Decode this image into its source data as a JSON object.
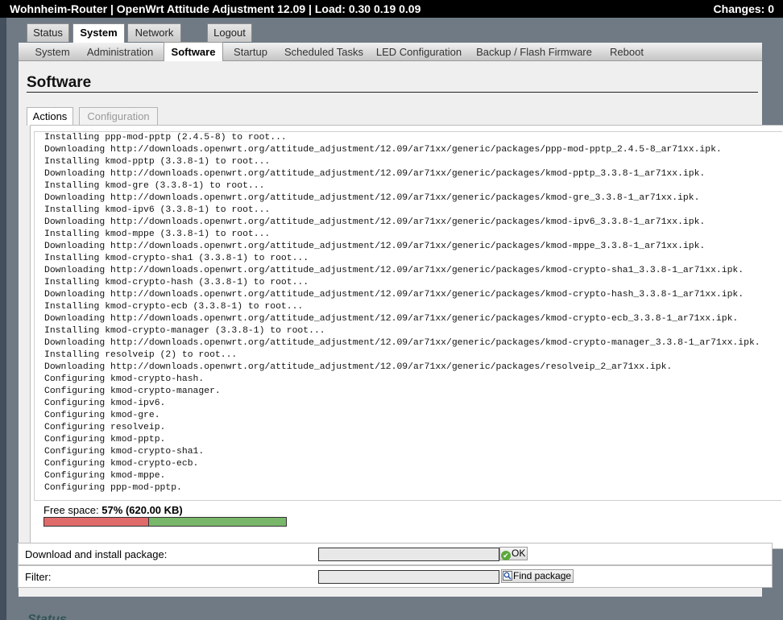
{
  "topbar": {
    "title": "Wohnheim-Router | OpenWrt Attitude Adjustment 12.09 | Load: 0.30 0.19 0.09",
    "changes": "Changes: 0"
  },
  "main_tabs": [
    {
      "label": "Status",
      "active": false
    },
    {
      "label": "System",
      "active": true
    },
    {
      "label": "Network",
      "active": false
    },
    {
      "label": "Logout",
      "active": false
    }
  ],
  "sub_tabs": [
    {
      "label": "System",
      "active": false
    },
    {
      "label": "Administration",
      "active": false
    },
    {
      "label": "Software",
      "active": true
    },
    {
      "label": "Startup",
      "active": false
    },
    {
      "label": "Scheduled Tasks",
      "active": false
    },
    {
      "label": "LED Configuration",
      "active": false
    },
    {
      "label": "Backup / Flash Firmware",
      "active": false
    },
    {
      "label": "Reboot",
      "active": false
    }
  ],
  "page": {
    "title": "Software",
    "content_tabs": [
      {
        "label": "Actions",
        "active": true
      },
      {
        "label": "Configuration",
        "active": false
      }
    ]
  },
  "log_lines": [
    "Installing ppp-mod-pptp (2.4.5-8) to root...",
    "Downloading http://downloads.openwrt.org/attitude_adjustment/12.09/ar71xx/generic/packages/ppp-mod-pptp_2.4.5-8_ar71xx.ipk.",
    "Installing kmod-pptp (3.3.8-1) to root...",
    "Downloading http://downloads.openwrt.org/attitude_adjustment/12.09/ar71xx/generic/packages/kmod-pptp_3.3.8-1_ar71xx.ipk.",
    "Installing kmod-gre (3.3.8-1) to root...",
    "Downloading http://downloads.openwrt.org/attitude_adjustment/12.09/ar71xx/generic/packages/kmod-gre_3.3.8-1_ar71xx.ipk.",
    "Installing kmod-ipv6 (3.3.8-1) to root...",
    "Downloading http://downloads.openwrt.org/attitude_adjustment/12.09/ar71xx/generic/packages/kmod-ipv6_3.3.8-1_ar71xx.ipk.",
    "Installing kmod-mppe (3.3.8-1) to root...",
    "Downloading http://downloads.openwrt.org/attitude_adjustment/12.09/ar71xx/generic/packages/kmod-mppe_3.3.8-1_ar71xx.ipk.",
    "Installing kmod-crypto-sha1 (3.3.8-1) to root...",
    "Downloading http://downloads.openwrt.org/attitude_adjustment/12.09/ar71xx/generic/packages/kmod-crypto-sha1_3.3.8-1_ar71xx.ipk.",
    "Installing kmod-crypto-hash (3.3.8-1) to root...",
    "Downloading http://downloads.openwrt.org/attitude_adjustment/12.09/ar71xx/generic/packages/kmod-crypto-hash_3.3.8-1_ar71xx.ipk.",
    "Installing kmod-crypto-ecb (3.3.8-1) to root...",
    "Downloading http://downloads.openwrt.org/attitude_adjustment/12.09/ar71xx/generic/packages/kmod-crypto-ecb_3.3.8-1_ar71xx.ipk.",
    "Installing kmod-crypto-manager (3.3.8-1) to root...",
    "Downloading http://downloads.openwrt.org/attitude_adjustment/12.09/ar71xx/generic/packages/kmod-crypto-manager_3.3.8-1_ar71xx.ipk.",
    "Installing resolveip (2) to root...",
    "Downloading http://downloads.openwrt.org/attitude_adjustment/12.09/ar71xx/generic/packages/resolveip_2_ar71xx.ipk.",
    "Configuring kmod-crypto-hash.",
    "Configuring kmod-crypto-manager.",
    "Configuring kmod-ipv6.",
    "Configuring kmod-gre.",
    "Configuring resolveip.",
    "Configuring kmod-pptp.",
    "Configuring kmod-crypto-sha1.",
    "Configuring kmod-crypto-ecb.",
    "Configuring kmod-mppe.",
    "Configuring ppp-mod-pptp."
  ],
  "free_space": {
    "label": "Free space:",
    "percent_text": "57%",
    "size_text": "(620.00 KB)",
    "used_fraction": 0.43
  },
  "form": {
    "download_label": "Download and install package:",
    "download_value": "",
    "ok_label": "OK",
    "filter_label": "Filter:",
    "filter_value": "",
    "find_label": "Find package"
  },
  "colors": {
    "bar_used": "#e06b6b",
    "bar_free": "#79b76a",
    "background": "#434f5c"
  }
}
